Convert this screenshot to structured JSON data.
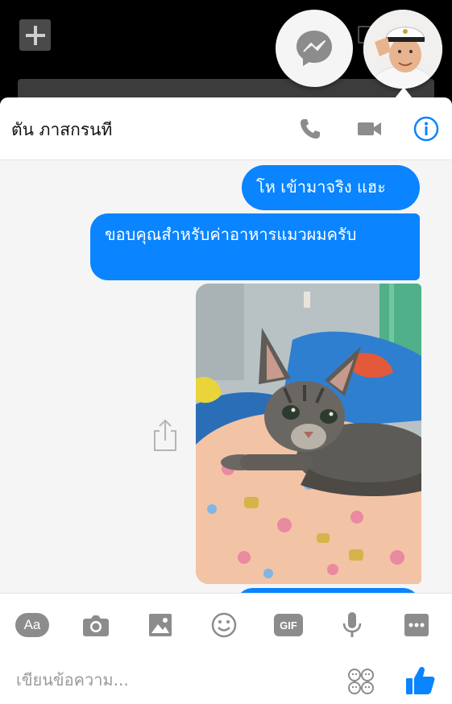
{
  "top": {
    "add_icon": "plus-icon",
    "chat_heads": [
      {
        "name": "messenger",
        "icon": "messenger-icon"
      },
      {
        "name": "contact-avatar",
        "icon": "avatar"
      }
    ]
  },
  "header": {
    "contact_name": "ตัน ภาสกรนที",
    "icons": [
      "phone-icon",
      "video-icon",
      "info-icon"
    ],
    "accent": "#0a84ff"
  },
  "messages": [
    {
      "type": "text",
      "from": "me",
      "text": "โห เข้ามาจริง แฮะ"
    },
    {
      "type": "text",
      "from": "me",
      "text": "ขอบคุณสำหรับค่าอาหารแมวผมครับ"
    },
    {
      "type": "image",
      "from": "me",
      "alt": ""
    }
  ],
  "composer": {
    "tools": [
      {
        "name": "aa",
        "label": "Aa"
      },
      {
        "name": "camera",
        "icon": "camera-icon"
      },
      {
        "name": "image",
        "icon": "image-icon"
      },
      {
        "name": "sticker",
        "icon": "smiley-icon"
      },
      {
        "name": "gif",
        "label": "GIF"
      },
      {
        "name": "mic",
        "icon": "mic-icon"
      },
      {
        "name": "more",
        "icon": "more-icon"
      }
    ],
    "placeholder": "เขียนข้อความ...",
    "like_icon": "thumbs-up-icon"
  },
  "colors": {
    "bubble": "#0a84ff",
    "tool_gray": "#8c8c8c"
  }
}
